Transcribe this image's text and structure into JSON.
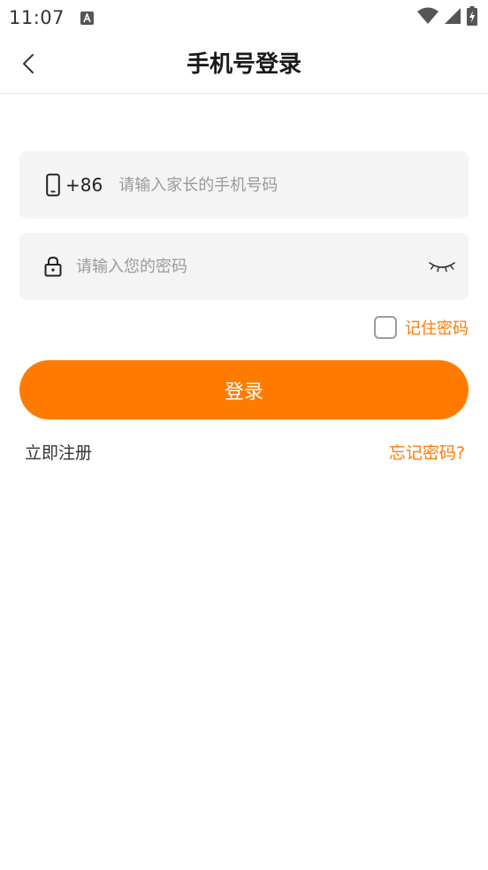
{
  "status_bar": {
    "time": "11:07",
    "notification_icon": "a-icon",
    "wifi_icon": "wifi-icon",
    "signal_icon": "signal-icon",
    "battery_icon": "battery-charging-icon"
  },
  "header": {
    "title": "手机号登录",
    "back_icon": "chevron-left-icon"
  },
  "phone_field": {
    "icon": "phone-icon",
    "country_code": "+86",
    "value": "",
    "placeholder": "请输入家长的手机号码"
  },
  "password_field": {
    "icon": "lock-icon",
    "value": "",
    "placeholder": "请输入您的密码",
    "visibility_icon": "eye-closed-icon"
  },
  "remember": {
    "label": "记住密码",
    "checked": false
  },
  "login_button": {
    "label": "登录"
  },
  "links": {
    "register": "立即注册",
    "forgot": "忘记密码?"
  },
  "colors": {
    "accent": "#ff7b00",
    "field_background": "#f4f4f4",
    "placeholder": "#9a9a9a"
  }
}
